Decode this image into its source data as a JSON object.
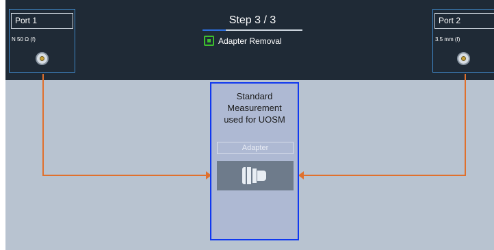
{
  "header": {
    "step_title": "Step 3 / 3",
    "step_subtitle": "Adapter Removal"
  },
  "ports": {
    "left": {
      "name": "Port 1",
      "connector": "N 50 Ω (f)"
    },
    "right": {
      "name": "Port 2",
      "connector": "3.5 mm (f)"
    }
  },
  "standard": {
    "title_lines": [
      "Standard",
      "Measurement",
      "used for UOSM"
    ],
    "adapter_label": "Adapter"
  },
  "colors": {
    "header_bg": "#1f2a36",
    "canvas_bg": "#b8c3d0",
    "port_border": "#3f87c6",
    "standard_border": "#1038f0",
    "connection_line": "#e0702c",
    "step_progress": "#2d6fe0",
    "adapter_icon": "#3dbf2e"
  },
  "icons": {
    "step_icon": "adapter-icon",
    "port_icon": "connector-icon",
    "standard_icon": "adapter-shape-icon"
  }
}
